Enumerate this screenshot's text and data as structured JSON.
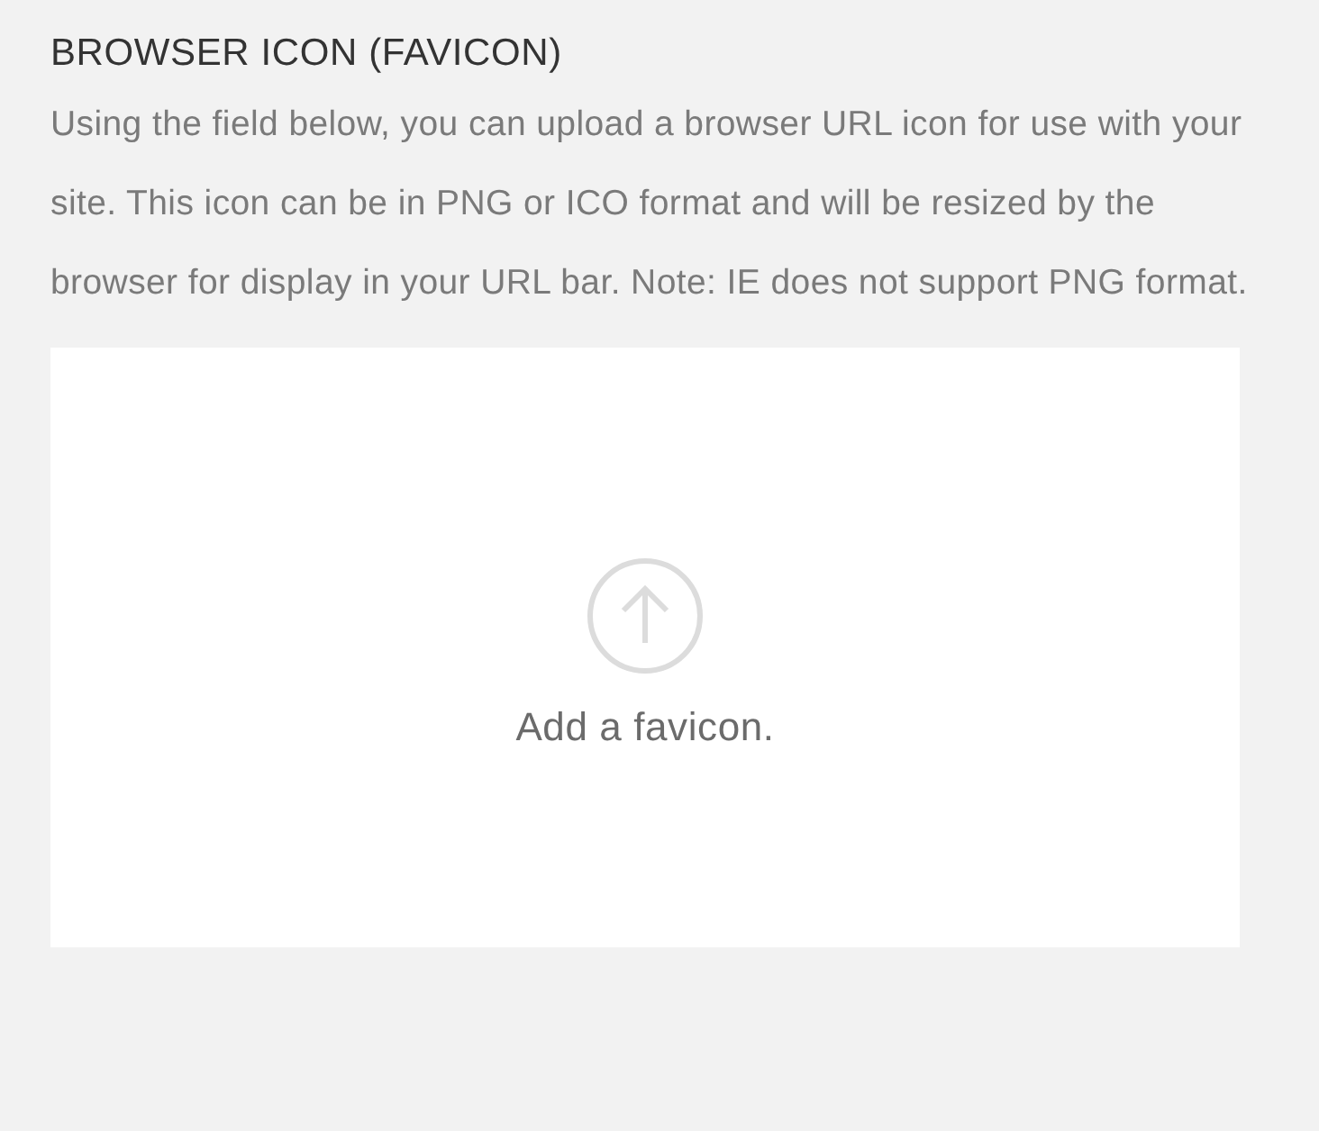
{
  "section": {
    "title": "BROWSER ICON (FAVICON)",
    "description": "Using the field below, you can upload a browser URL icon for use with your site. This icon can be in PNG or ICO format and will be resized by the browser for display in your URL bar. Note: IE does not support PNG format."
  },
  "upload": {
    "label": "Add a favicon."
  }
}
